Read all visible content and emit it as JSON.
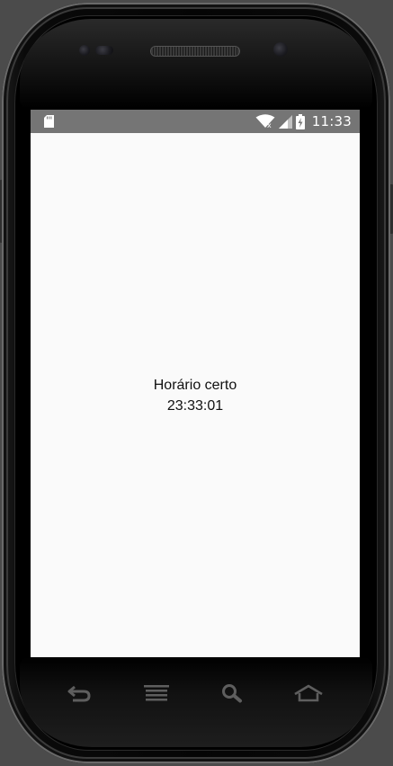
{
  "device": {
    "frame": "android-emulator-nexus-s"
  },
  "status_bar": {
    "time": "11:33",
    "icons": [
      "sd-card-icon",
      "wifi-icon",
      "signal-icon",
      "battery-icon"
    ]
  },
  "app": {
    "title_label": "Horário certo",
    "time_value": "23:33:01"
  },
  "nav_bar": {
    "buttons": [
      "back-icon",
      "menu-icon",
      "search-icon",
      "home-icon"
    ]
  },
  "colors": {
    "status_bar_bg": "#757575",
    "screen_bg": "#fafafa",
    "text": "#111111",
    "nav_icon": "#5e5e5e"
  }
}
